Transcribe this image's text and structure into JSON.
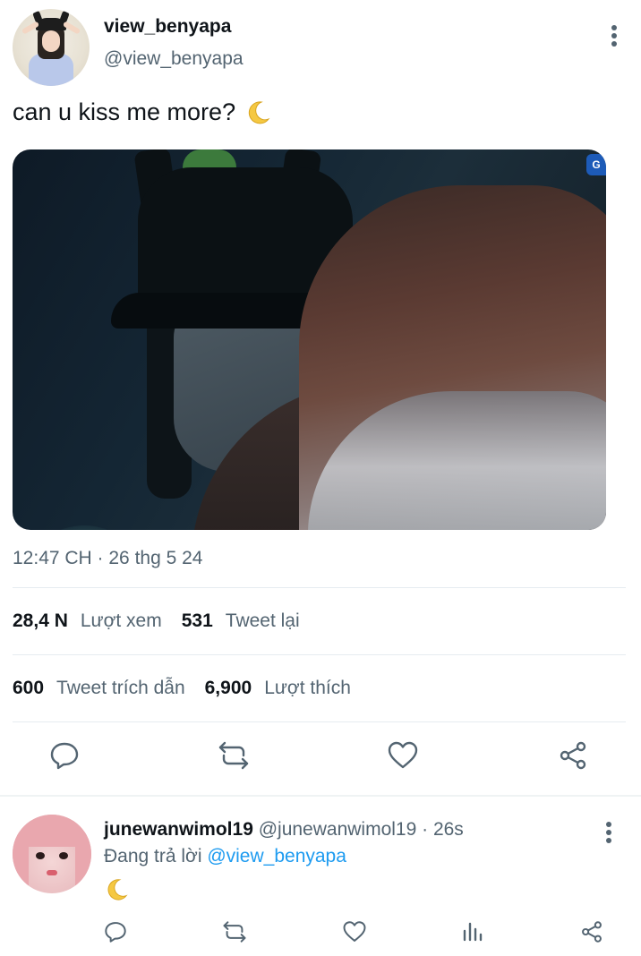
{
  "tweet": {
    "display_name": "view_benyapa",
    "handle": "@view_benyapa",
    "text": "can u kiss me more?",
    "emoji": "crescent-moon",
    "timestamp": "12:47 CH · 26 thg 5 24",
    "media_badge": "G",
    "stats": {
      "views_num": "28,4 N",
      "views_label": "Lượt xem",
      "retweets_num": "531",
      "retweets_label": "Tweet lại",
      "quotes_num": "600",
      "quotes_label": "Tweet trích dẫn",
      "likes_num": "6,900",
      "likes_label": "Lượt thích"
    },
    "actions": [
      "reply-icon",
      "retweet-icon",
      "like-icon",
      "share-icon"
    ]
  },
  "reply": {
    "display_name": "junewanwimol19",
    "handle_time": "@junewanwimol19 · 26s",
    "replying_prefix": "Đang trả lời",
    "replying_to": "@view_benyapa",
    "emoji": "crescent-moon",
    "actions": [
      "reply-icon",
      "retweet-icon",
      "like-icon",
      "analytics-icon",
      "share-icon"
    ]
  },
  "colors": {
    "text_primary": "#0f1419",
    "text_secondary": "#536471",
    "link": "#1d9bf0",
    "divider": "#e6ecf0",
    "moon": "#f5c842"
  }
}
